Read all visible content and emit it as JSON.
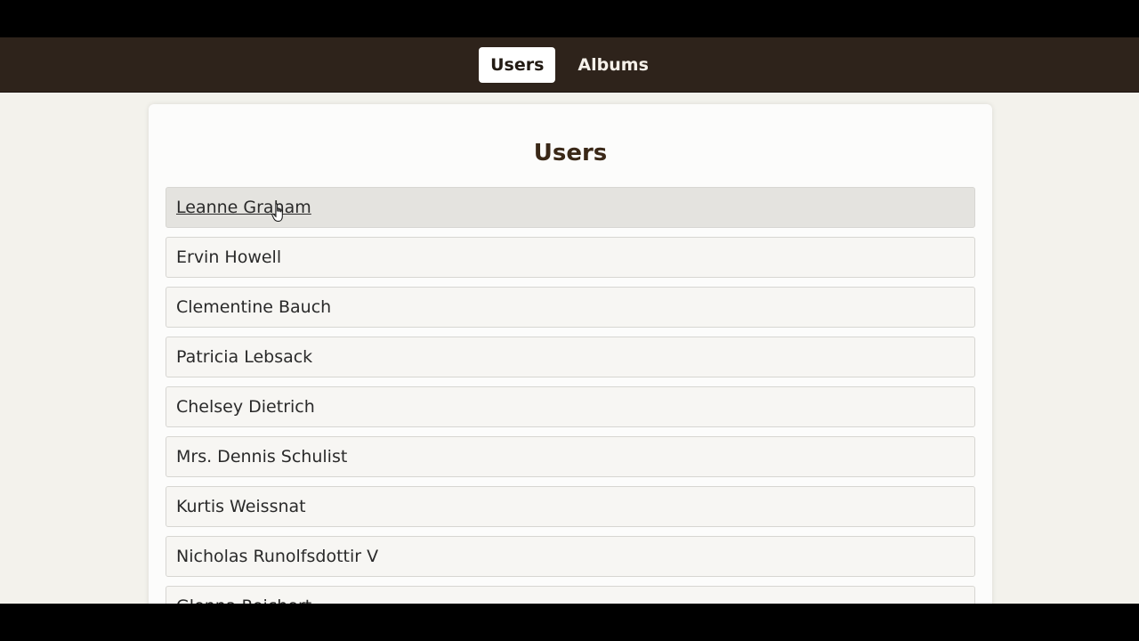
{
  "nav": {
    "links": [
      {
        "label": "Users",
        "active": true
      },
      {
        "label": "Albums",
        "active": false
      }
    ]
  },
  "main": {
    "title": "Users",
    "users": [
      "Leanne Graham",
      "Ervin Howell",
      "Clementine Bauch",
      "Patricia Lebsack",
      "Chelsey Dietrich",
      "Mrs. Dennis Schulist",
      "Kurtis Weissnat",
      "Nicholas Runolfsdottir V",
      "Glenna Reichert"
    ],
    "hovered_index": 0
  },
  "colors": {
    "navbar_bg": "#2e231b",
    "page_bg": "#f3f2ec",
    "title_color": "#3a2817",
    "hover_bg": "#e4e3df"
  },
  "icons": {
    "cursor": "hand-pointer-icon"
  }
}
